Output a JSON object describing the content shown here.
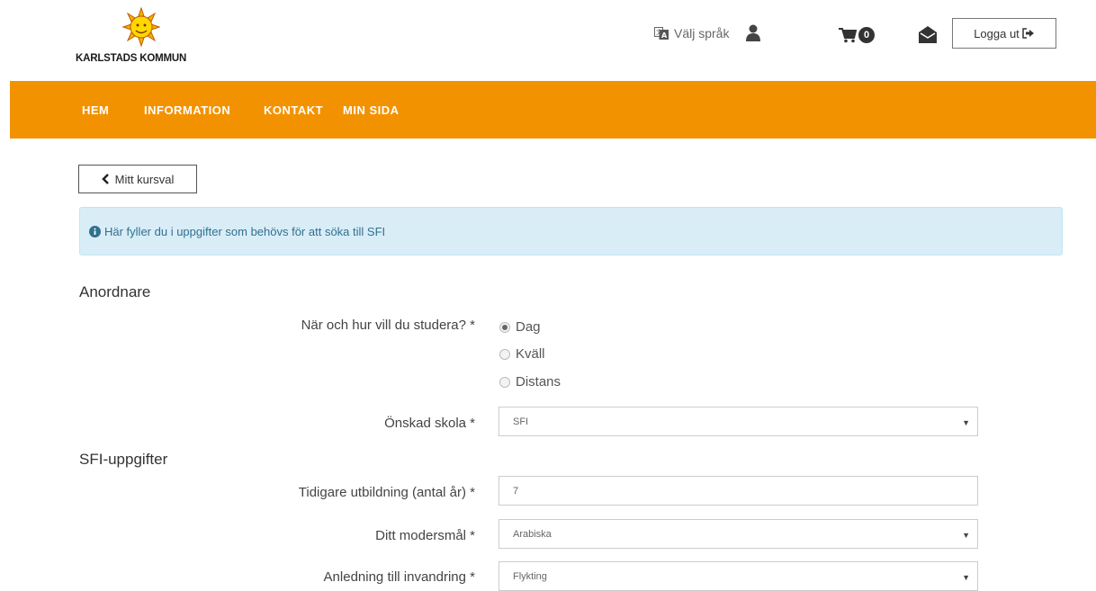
{
  "header": {
    "logo_text": "KARLSTADS KOMMUN",
    "language_label": "Välj språk",
    "cart_count": "0",
    "logout_label": "Logga ut"
  },
  "nav": {
    "items": [
      "HEM",
      "INFORMATION",
      "KONTAKT",
      "MIN SIDA"
    ]
  },
  "back_button": {
    "label": "Mitt kursval"
  },
  "info_alert": {
    "text": "Här fyller du i uppgifter som behövs för att söka till SFI"
  },
  "sections": {
    "anordnare": "Anordnare",
    "sfi": "SFI-uppgifter"
  },
  "form": {
    "study_label": "När och hur vill du studera? *",
    "study_options": [
      "Dag",
      "Kväll",
      "Distans"
    ],
    "study_selected": "Dag",
    "school_label": "Önskad skola *",
    "school_value": "SFI",
    "education_label": "Tidigare utbildning (antal år) *",
    "education_value": "7",
    "language_label": "Ditt modersmål *",
    "language_value": "Arabiska",
    "immigration_label": "Anledning till invandring *",
    "immigration_value": "Flykting"
  },
  "colors": {
    "nav_bg": "#f39200",
    "alert_bg": "#d9edf7",
    "alert_text": "#31708f"
  },
  "icons": [
    "sun-logo-icon",
    "translate-icon",
    "user-icon",
    "cart-icon",
    "envelope-icon",
    "sign-out-icon",
    "chevron-left-icon",
    "info-circle-icon"
  ]
}
